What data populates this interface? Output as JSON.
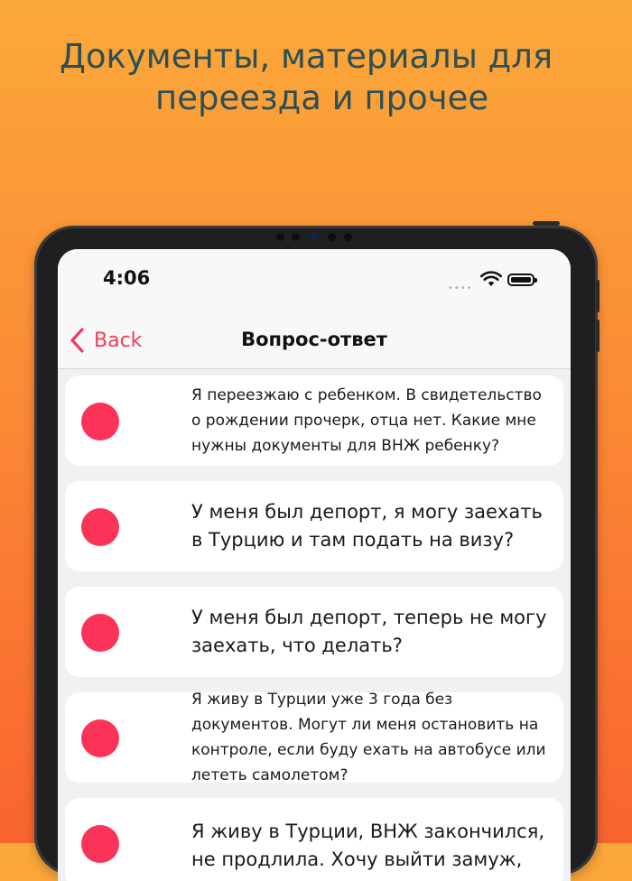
{
  "headline": {
    "line1": "Документы, материалы для",
    "line2": "переезда и прочее"
  },
  "status_bar": {
    "time": "4:06"
  },
  "nav": {
    "back_label": "Back",
    "title": "Вопрос-ответ"
  },
  "items": [
    {
      "text": "Я переезжаю с ребенком. В свидетельство о рождении прочерк, отца нет. Какие мне нужны документы для ВНЖ ребенку?"
    },
    {
      "text": "У меня был депорт, я могу заехать в Турцию и там подать на визу?"
    },
    {
      "text": "У меня был депорт, теперь не могу заехать, что делать?"
    },
    {
      "text": "Я живу в Турции уже 3 года без документов. Могут ли меня остановить на контроле, если буду ехать на автобусе или лететь самолетом?"
    },
    {
      "text": "Я живу в Турции, ВНЖ закончился, не продлила. Хочу выйти замуж, что"
    }
  ],
  "colors": {
    "accent": "#FC3358",
    "back_tint": "#F23A5C",
    "headline": "#2D4F55",
    "bg_top": "#FBA83A",
    "bg_bottom": "#F9642F"
  },
  "icons": [
    "chevron-left-icon",
    "wifi-icon",
    "battery-icon",
    "signal-dots-icon"
  ]
}
